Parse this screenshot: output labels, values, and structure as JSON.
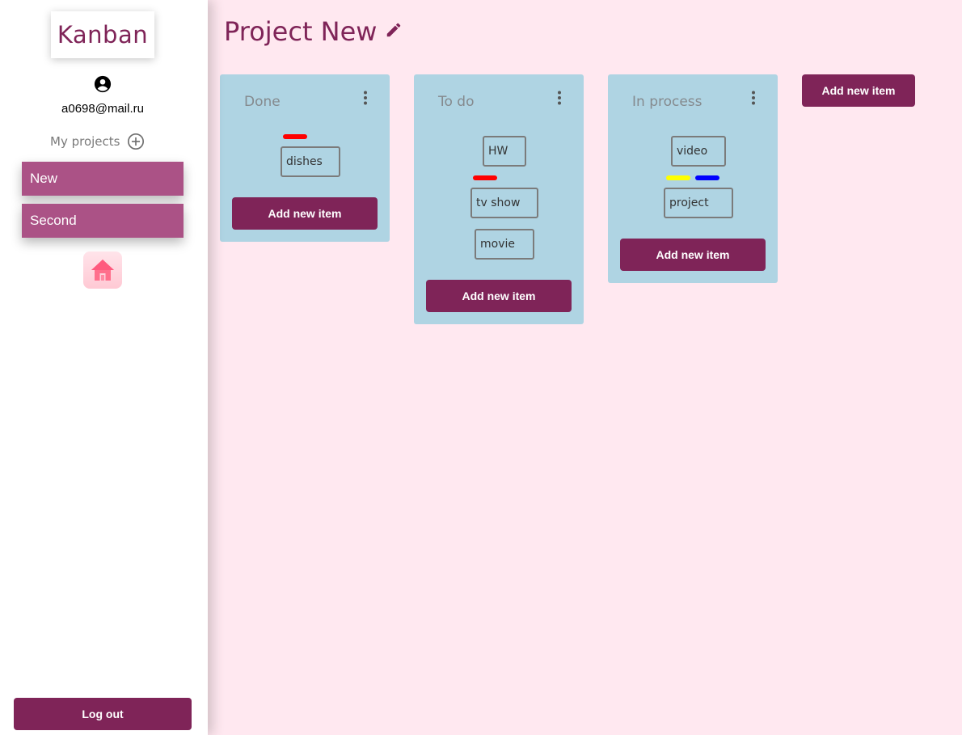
{
  "sidebar": {
    "logo": "Kanban",
    "user_icon": "account-circle-icon",
    "email": "a0698@mail.ru",
    "projects_label": "My projects",
    "add_project_icon": "plus-circle-icon",
    "projects": [
      {
        "label": "New"
      },
      {
        "label": "Second"
      }
    ],
    "home_icon": "home-icon",
    "logout_label": "Log out"
  },
  "main": {
    "title": "Project New",
    "edit_icon": "pencil-icon",
    "add_column_label": "Add new item",
    "columns": [
      {
        "title": "Done",
        "add_label": "Add new item",
        "cards": [
          {
            "text": "dishes",
            "tags": [
              "#ff0000"
            ]
          }
        ]
      },
      {
        "title": "To do",
        "add_label": "Add new item",
        "cards": [
          {
            "text": "HW",
            "tags": []
          },
          {
            "text": "tv show",
            "tags": [
              "#ff0000"
            ]
          },
          {
            "text": "movie",
            "tags": []
          }
        ]
      },
      {
        "title": "In process",
        "add_label": "Add new item",
        "cards": [
          {
            "text": "video",
            "tags": []
          },
          {
            "text": "project",
            "tags": [
              "#ffff00",
              "#0000ff"
            ]
          }
        ]
      }
    ]
  },
  "colors": {
    "accent": "#7f2458",
    "project_item": "#ab5286",
    "column_bg": "#afd4e3",
    "page_bg": "#ffe8f0"
  }
}
